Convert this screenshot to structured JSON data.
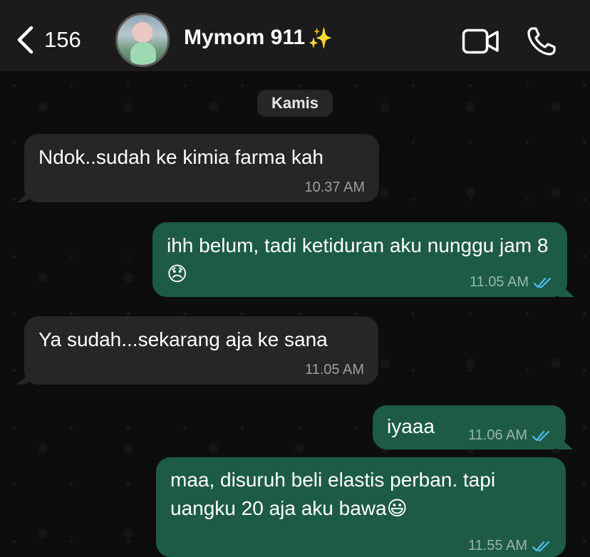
{
  "header": {
    "back_count": "156",
    "contact_name": "Mymom 911",
    "contact_emoji": "✨"
  },
  "day_label": "Kamis",
  "messages": [
    {
      "direction": "in",
      "text": "Ndok..sudah ke kimia farma kah",
      "time": "10.37 AM"
    },
    {
      "direction": "out",
      "text": "ihh belum, tadi ketiduran aku nunggu jam 8",
      "emoji": "😞",
      "time": "11.05 AM",
      "status": "read"
    },
    {
      "direction": "in",
      "text": "Ya sudah...sekarang aja ke sana",
      "time": "11.05 AM"
    },
    {
      "direction": "out",
      "text": "iyaaa",
      "time": "11.06 AM",
      "status": "read"
    },
    {
      "direction": "out",
      "text": "maa, disuruh beli elastis perban. tapi uangku 20 aja aku bawa",
      "emoji": "😃",
      "time": "11.55 AM",
      "status": "read"
    }
  ],
  "icons": {
    "back": "chevron-left-icon",
    "video": "video-camera-icon",
    "call": "phone-icon",
    "read_receipt": "double-check-icon"
  },
  "colors": {
    "incoming_bubble": "#262627",
    "outgoing_bubble": "#1d5b46",
    "read_tick": "#53bdeb",
    "header_bg": "#1b1b1b"
  }
}
